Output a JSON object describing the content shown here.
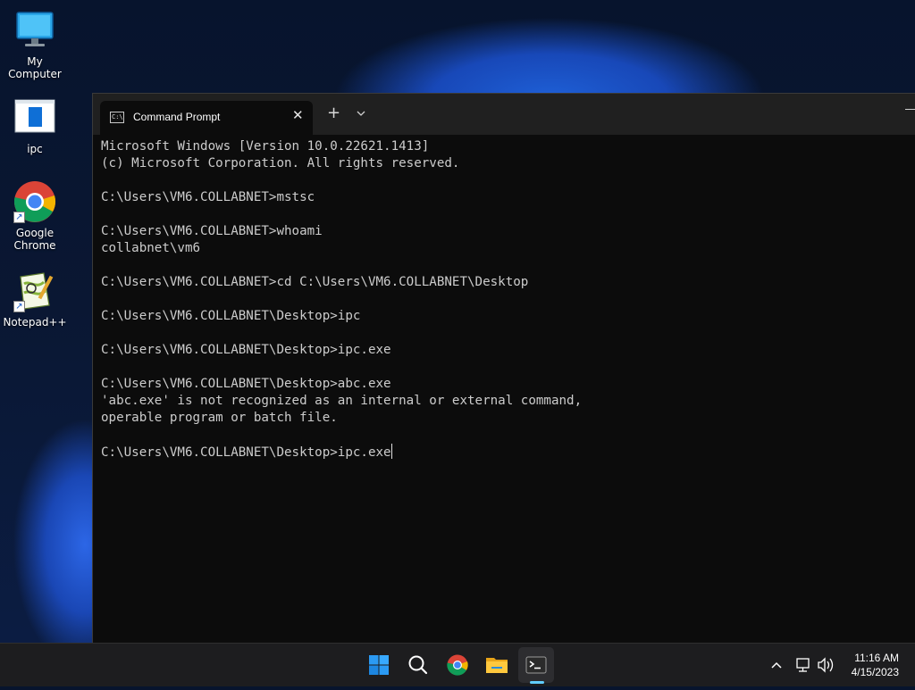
{
  "desktop": {
    "icons": [
      {
        "label": "My Computer"
      },
      {
        "label": "ipc"
      },
      {
        "label": "Google\nChrome"
      },
      {
        "label": "Notepad++"
      }
    ]
  },
  "window": {
    "tab_title": "Command Prompt",
    "console_lines": [
      "Microsoft Windows [Version 10.0.22621.1413]",
      "(c) Microsoft Corporation. All rights reserved.",
      "",
      "C:\\Users\\VM6.COLLABNET>mstsc",
      "",
      "C:\\Users\\VM6.COLLABNET>whoami",
      "collabnet\\vm6",
      "",
      "C:\\Users\\VM6.COLLABNET>cd C:\\Users\\VM6.COLLABNET\\Desktop",
      "",
      "C:\\Users\\VM6.COLLABNET\\Desktop>ipc",
      "",
      "C:\\Users\\VM6.COLLABNET\\Desktop>ipc.exe",
      "",
      "C:\\Users\\VM6.COLLABNET\\Desktop>abc.exe",
      "'abc.exe' is not recognized as an internal or external command,",
      "operable program or batch file.",
      ""
    ],
    "current_prompt": "C:\\Users\\VM6.COLLABNET\\Desktop>ipc.exe"
  },
  "taskbar": {
    "apps": [
      "start-icon",
      "search-icon",
      "chrome-icon",
      "file-explorer-icon",
      "terminal-icon"
    ],
    "active_app": "terminal-icon",
    "accent": "#60cdff"
  },
  "clock": {
    "time": "11:16 AM",
    "date": "4/15/2023"
  }
}
